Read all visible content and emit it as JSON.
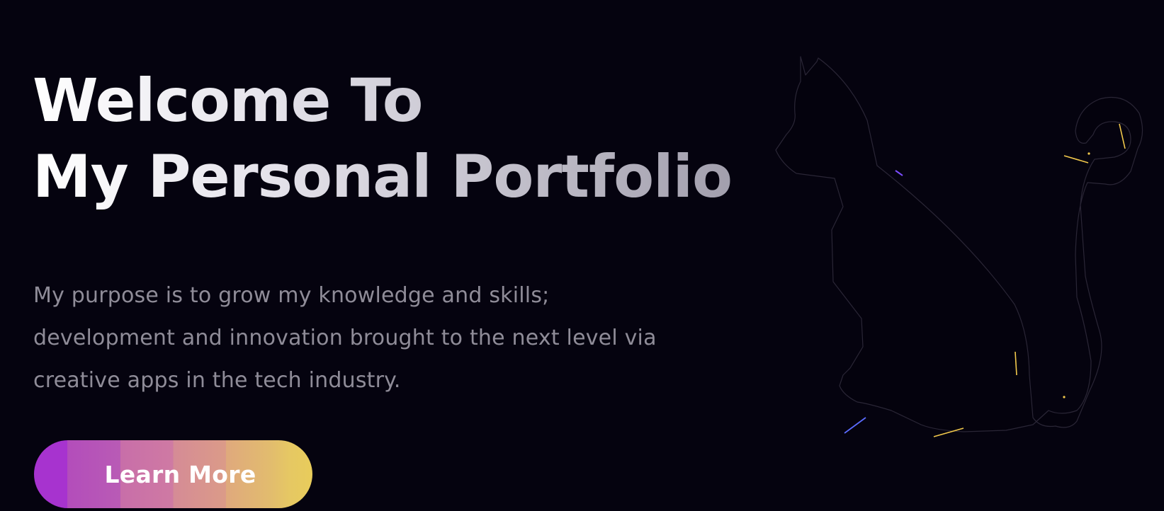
{
  "hero": {
    "title_line_1": "Welcome To",
    "title_line_2": "My Personal Portfolio",
    "subtitle_line_1": "My purpose is to grow my knowledge and skills;",
    "subtitle_line_2": "development and innovation brought to the next level via",
    "subtitle_line_3": "creative apps in the tech industry.",
    "cta_label": "Learn More"
  },
  "colors": {
    "background": "#05030f",
    "title": "#ffffff",
    "subtitle": "#8f8c98",
    "cta_gradient_start": "#a733cf",
    "cta_gradient_end": "#e8cc5b",
    "accent_purple": "#7c4dff",
    "accent_yellow": "#f2c94c"
  },
  "icons": {
    "illustration": "cat-silhouette-outline"
  }
}
